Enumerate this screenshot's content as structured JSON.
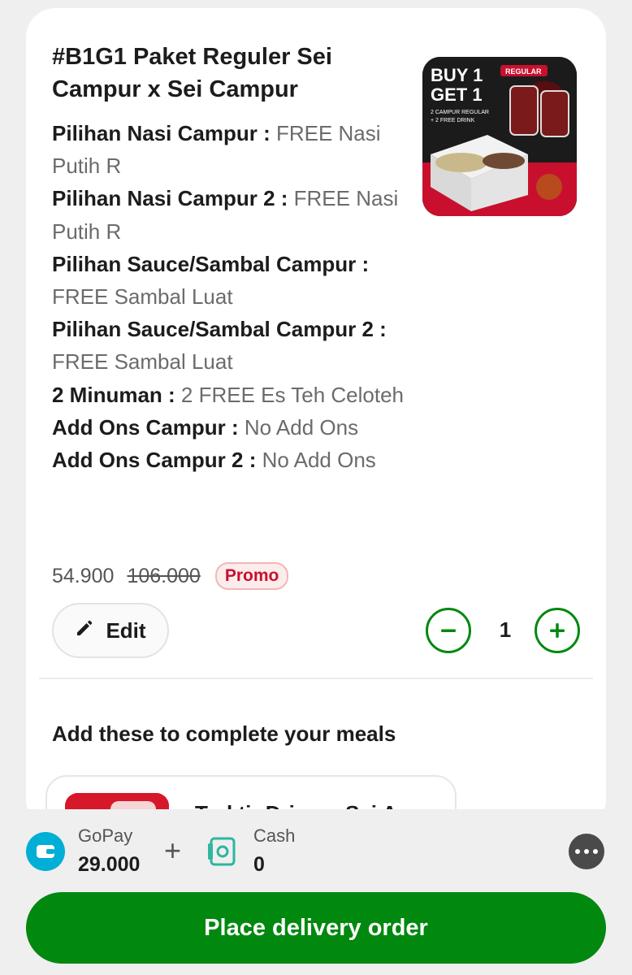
{
  "item": {
    "title": "#B1G1 Paket Reguler Sei Campur x Sei Campur",
    "image_alt": "BUY 1 GET 1",
    "image_badge": "REGULAR",
    "image_sub": "2 CAMPUR REGULAR + 2 FREE DRINK",
    "options": [
      {
        "name": "Pilihan Nasi Campur : ",
        "value": "FREE Nasi Putih R"
      },
      {
        "name": "Pilihan Nasi Campur 2 : ",
        "value": "FREE Nasi Putih R"
      },
      {
        "name": "Pilihan Sauce/Sambal Campur : ",
        "value": "FREE Sambal Luat"
      },
      {
        "name": "Pilihan Sauce/Sambal Campur 2 : ",
        "value": "FREE Sambal Luat"
      },
      {
        "name": "2 Minuman : ",
        "value": "2 FREE Es Teh Celoteh"
      },
      {
        "name": "Add Ons Campur : ",
        "value": "No Add Ons"
      },
      {
        "name": "Add Ons Campur 2 : ",
        "value": "No Add Ons"
      }
    ],
    "price": "54.900",
    "original_price": "106.000",
    "promo_label": "Promo",
    "edit_label": "Edit",
    "quantity": "1"
  },
  "recommendations": {
    "title": "Add these to complete your meals",
    "items": [
      {
        "title": "Traktir Driver - Sei Ayam"
      }
    ]
  },
  "payment": {
    "gopay_label": "GoPay",
    "gopay_amount": "29.000",
    "plus": "+",
    "cash_label": "Cash",
    "cash_amount": "0"
  },
  "cta": {
    "label": "Place delivery order"
  },
  "colors": {
    "brand_green": "#00880f",
    "promo_red": "#c8102e",
    "gopay_blue": "#00aed6"
  }
}
